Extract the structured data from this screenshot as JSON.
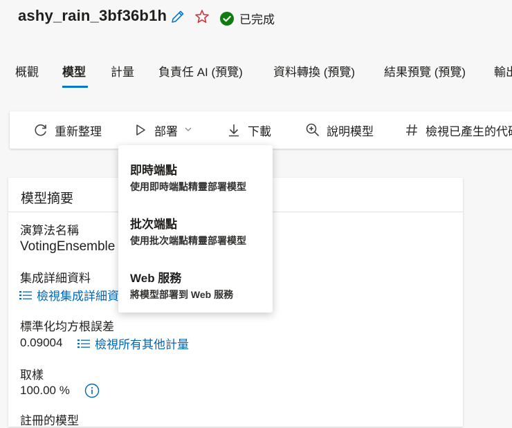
{
  "header": {
    "title": "ashy_rain_3bf36b1h",
    "status": "已完成",
    "colors": {
      "accent": "#0078d4",
      "star": "#d13438",
      "success": "#107c10",
      "link": "#0067b8"
    }
  },
  "tabs": [
    {
      "label": "概觀"
    },
    {
      "label": "模型"
    },
    {
      "label": "計量"
    },
    {
      "label": "負責任 AI (預覽)"
    },
    {
      "label": "資料轉換 (預覽)"
    },
    {
      "label": "結果預覽 (預覽)"
    },
    {
      "label": "輸出"
    }
  ],
  "toolbar": {
    "refresh": "重新整理",
    "deploy": "部署",
    "download": "下載",
    "explain": "說明模型",
    "view_code": "檢視已產生的代碼"
  },
  "summary": {
    "title": "模型摘要",
    "algorithm_label": "演算法名稱",
    "algorithm_value": "VotingEnsemble",
    "ensemble_label": "集成詳細資料",
    "ensemble_link": "檢視集成詳細資料",
    "metric_label": "標準化均方根誤差",
    "metric_value": "0.09004",
    "metric_link": "檢視所有其他計量",
    "sampling_label": "取樣",
    "sampling_value": "100.00 %",
    "registered_label": "註冊的模型"
  },
  "deploy_menu": {
    "items": [
      {
        "title": "即時端點",
        "desc": "使用即時端點精靈部署模型"
      },
      {
        "title": "批次端點",
        "desc": "使用批次端點精靈部署模型"
      },
      {
        "title": "Web 服務",
        "desc": "將模型部署到 Web 服務"
      }
    ]
  }
}
